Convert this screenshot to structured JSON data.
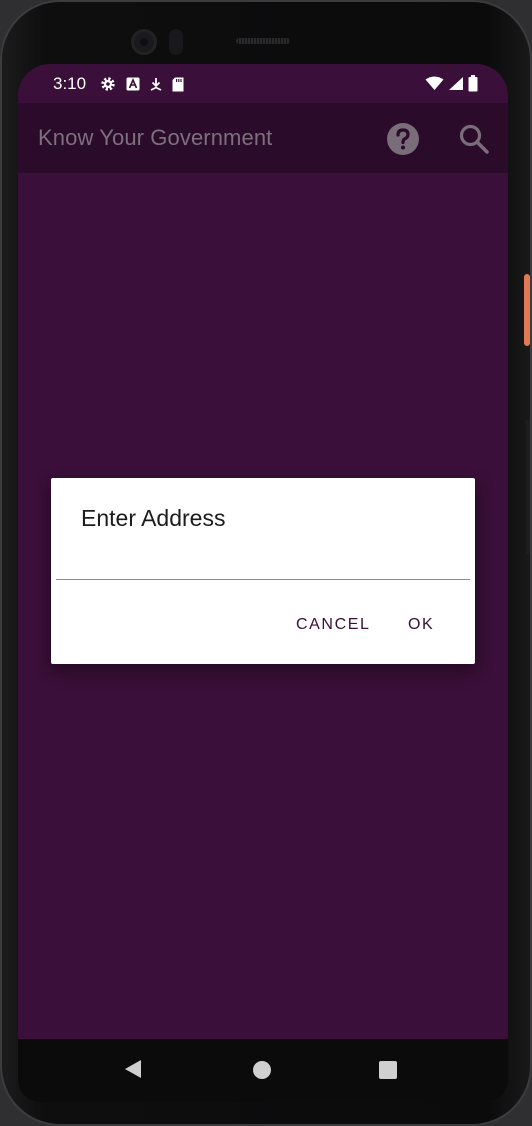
{
  "status_bar": {
    "time": "3:10",
    "left_icons": [
      "gear-icon",
      "font-a-icon",
      "download-icon",
      "sd-card-icon"
    ],
    "right_icons": [
      "wifi-icon",
      "signal-icon",
      "battery-icon"
    ]
  },
  "app_bar": {
    "title": "Know Your Government",
    "actions": [
      "help-icon",
      "search-icon"
    ]
  },
  "dialog": {
    "title": "Enter Address",
    "input_value": "",
    "cancel_label": "CANCEL",
    "ok_label": "OK"
  },
  "nav_bar": {
    "items": [
      "back-icon",
      "home-icon",
      "recents-icon"
    ]
  },
  "colors": {
    "background": "#3a0f39",
    "app_bar": "#2b0b2a",
    "accent": "#3a0f39",
    "dialog": "#ffffff"
  }
}
